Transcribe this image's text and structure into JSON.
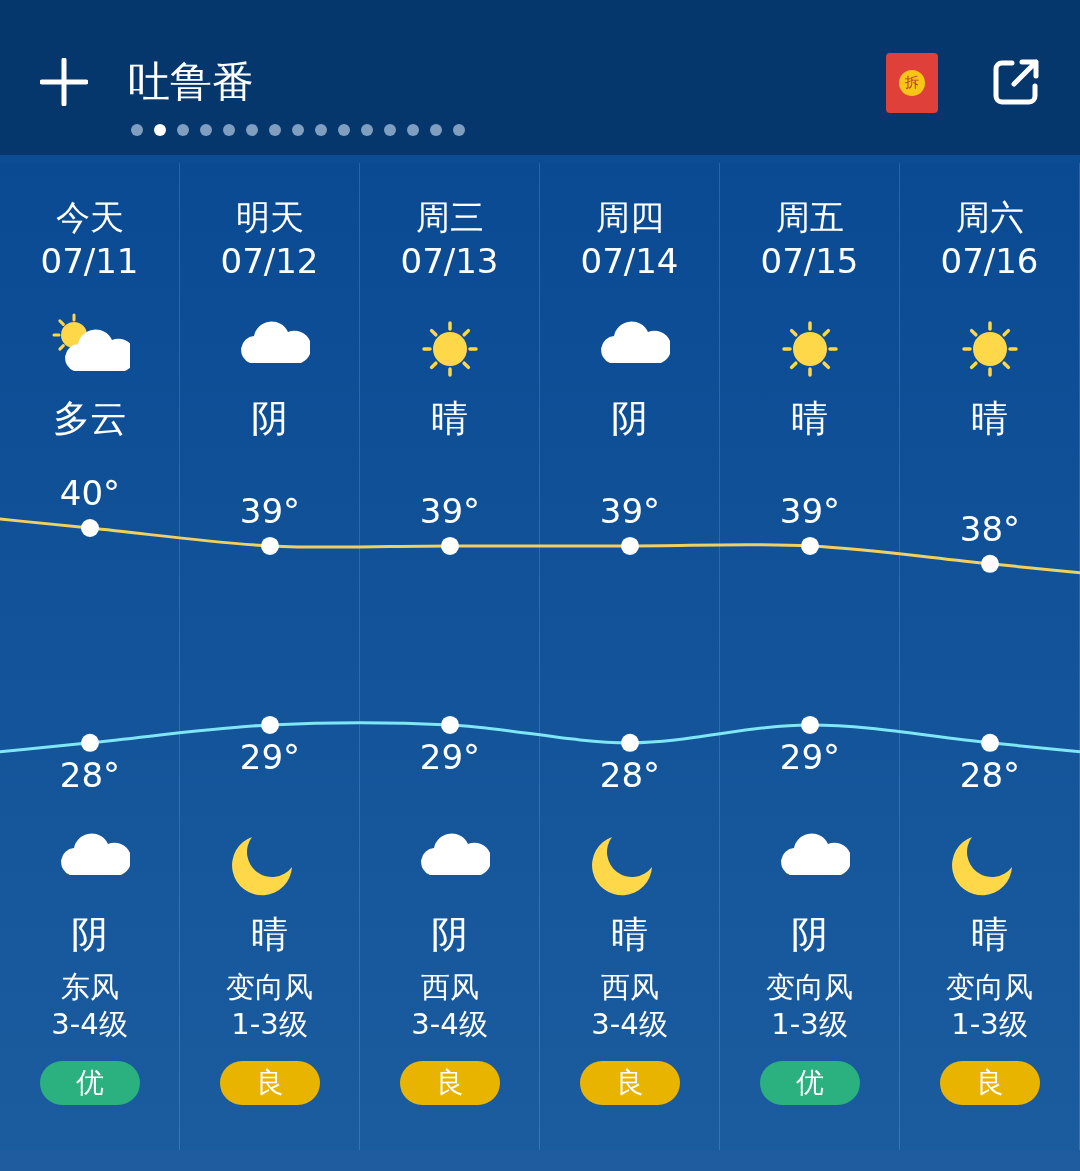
{
  "header": {
    "city": "吐鲁番",
    "envelope_label": "拆"
  },
  "pages": [
    {
      "selected": false
    },
    {
      "selected": true
    },
    {
      "selected": false
    },
    {
      "selected": false
    },
    {
      "selected": false
    },
    {
      "selected": false
    },
    {
      "selected": false
    },
    {
      "selected": false
    },
    {
      "selected": false
    },
    {
      "selected": false
    },
    {
      "selected": false
    },
    {
      "selected": false
    },
    {
      "selected": false
    },
    {
      "selected": false
    },
    {
      "selected": false
    }
  ],
  "days": [
    {
      "day": "今天",
      "date": "07/11",
      "day_icon": {
        "kind": "partly_cloudy"
      },
      "day_weather": "多云",
      "high": "40°",
      "low": "28°",
      "night_icon": {
        "kind": "cloudy"
      },
      "night_weather": "阴",
      "wind_dir": "东风",
      "wind_level": "3-4级",
      "aqi": {
        "label": "优",
        "color": "#2bb07f"
      }
    },
    {
      "day": "明天",
      "date": "07/12",
      "day_icon": {
        "kind": "cloudy"
      },
      "day_weather": "阴",
      "high": "39°",
      "low": "29°",
      "night_icon": {
        "kind": "moon"
      },
      "night_weather": "晴",
      "wind_dir": "变向风",
      "wind_level": "1-3级",
      "aqi": {
        "label": "良",
        "color": "#e8b400"
      }
    },
    {
      "day": "周三",
      "date": "07/13",
      "day_icon": {
        "kind": "sunny"
      },
      "day_weather": "晴",
      "high": "39°",
      "low": "29°",
      "night_icon": {
        "kind": "cloudy"
      },
      "night_weather": "阴",
      "wind_dir": "西风",
      "wind_level": "3-4级",
      "aqi": {
        "label": "良",
        "color": "#e8b400"
      }
    },
    {
      "day": "周四",
      "date": "07/14",
      "day_icon": {
        "kind": "cloudy"
      },
      "day_weather": "阴",
      "high": "39°",
      "low": "28°",
      "night_icon": {
        "kind": "moon"
      },
      "night_weather": "晴",
      "wind_dir": "西风",
      "wind_level": "3-4级",
      "aqi": {
        "label": "良",
        "color": "#e8b400"
      }
    },
    {
      "day": "周五",
      "date": "07/15",
      "day_icon": {
        "kind": "sunny"
      },
      "day_weather": "晴",
      "high": "39°",
      "low": "29°",
      "night_icon": {
        "kind": "cloudy"
      },
      "night_weather": "阴",
      "wind_dir": "变向风",
      "wind_level": "1-3级",
      "aqi": {
        "label": "优",
        "color": "#2bb07f"
      }
    },
    {
      "day": "周六",
      "date": "07/16",
      "day_icon": {
        "kind": "sunny"
      },
      "day_weather": "晴",
      "high": "38°",
      "low": "28°",
      "night_icon": {
        "kind": "moon"
      },
      "night_weather": "晴",
      "wind_dir": "变向风",
      "wind_level": "1-3级",
      "aqi": {
        "label": "良",
        "color": "#e8b400"
      }
    }
  ],
  "curves": [
    {
      "color": "#f0d060"
    },
    {
      "color": "#7fe6f5"
    }
  ]
}
